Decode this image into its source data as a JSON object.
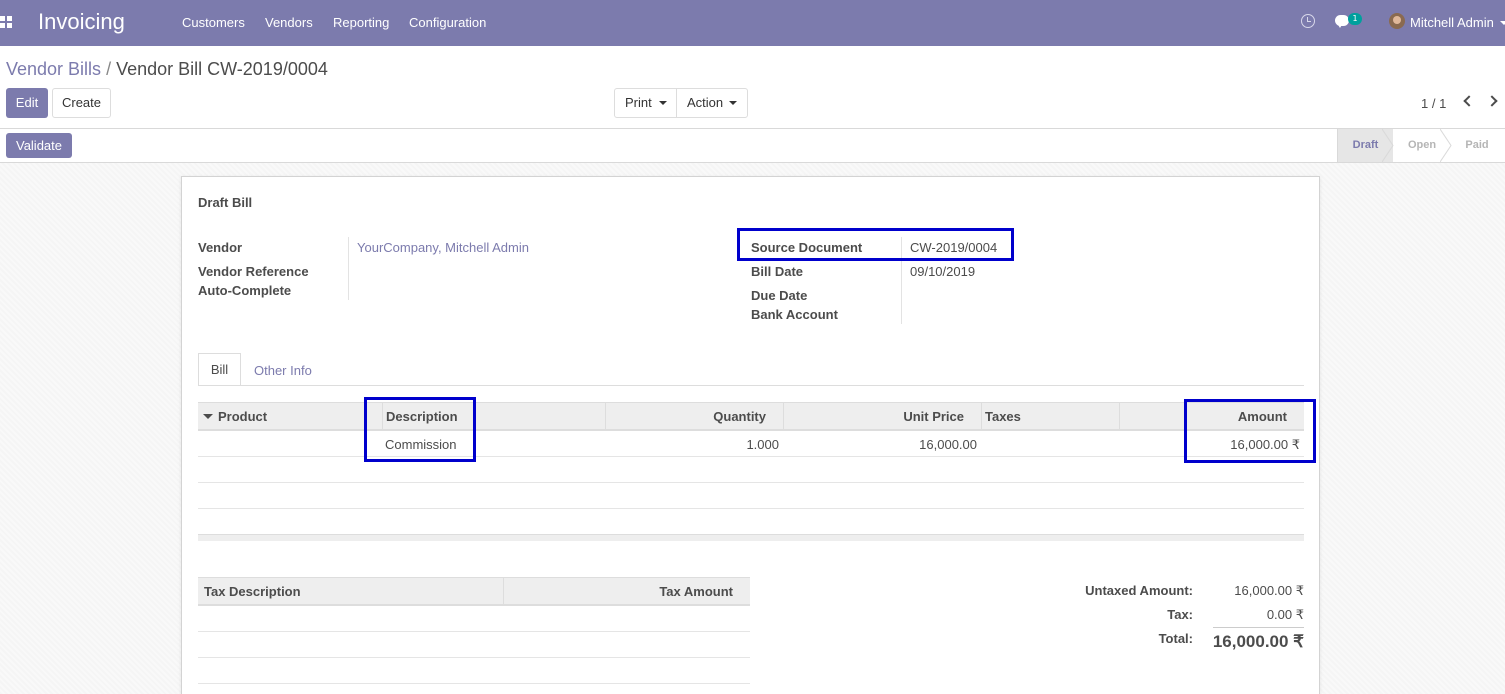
{
  "navbar": {
    "app_title": "Invoicing",
    "menu": [
      "Customers",
      "Vendors",
      "Reporting",
      "Configuration"
    ],
    "chat_badge": "1",
    "user_name": "Mitchell Admin",
    "icons": [
      "apps-icon",
      "clock-icon",
      "chat-icon",
      "avatar"
    ]
  },
  "breadcrumb": {
    "parent": "Vendor Bills",
    "separator": "/",
    "current": "Vendor Bill CW-2019/0004"
  },
  "buttons": {
    "edit": "Edit",
    "create": "Create",
    "print": "Print",
    "action": "Action",
    "validate": "Validate"
  },
  "pager": {
    "value": "1 / 1"
  },
  "status_steps": [
    {
      "label": "Draft",
      "active": true
    },
    {
      "label": "Open",
      "active": false
    },
    {
      "label": "Paid",
      "active": false
    }
  ],
  "form": {
    "title": "Draft Bill",
    "left_fields": {
      "vendor_label": "Vendor",
      "vendor_value": "YourCompany, Mitchell Admin",
      "vendor_ref_label": "Vendor Reference",
      "auto_complete_label": "Auto-Complete"
    },
    "right_fields": {
      "source_doc_label": "Source Document",
      "source_doc_value": "CW-2019/0004",
      "bill_date_label": "Bill Date",
      "bill_date_value": "09/10/2019",
      "due_date_label": "Due Date",
      "bank_account_label": "Bank Account"
    },
    "tabs": [
      "Bill",
      "Other Info"
    ],
    "lines": {
      "headers": [
        "Product",
        "Description",
        "Quantity",
        "Unit Price",
        "Taxes",
        "Amount"
      ],
      "rows": [
        {
          "product": "",
          "description": "Commission",
          "quantity": "1.000",
          "unit_price": "16,000.00",
          "taxes": "",
          "amount": "16,000.00 ₹"
        }
      ]
    },
    "tax_table": {
      "headers": [
        "Tax Description",
        "Tax Amount"
      ]
    },
    "totals": {
      "untaxed_label": "Untaxed Amount:",
      "untaxed_value": "16,000.00 ₹",
      "tax_label": "Tax:",
      "tax_value": "0.00 ₹",
      "total_label": "Total:",
      "total_value": "16,000.00 ₹"
    }
  },
  "colors": {
    "brand": "#7c7bad",
    "highlight": "#0000cc",
    "badge": "#00a09d"
  }
}
